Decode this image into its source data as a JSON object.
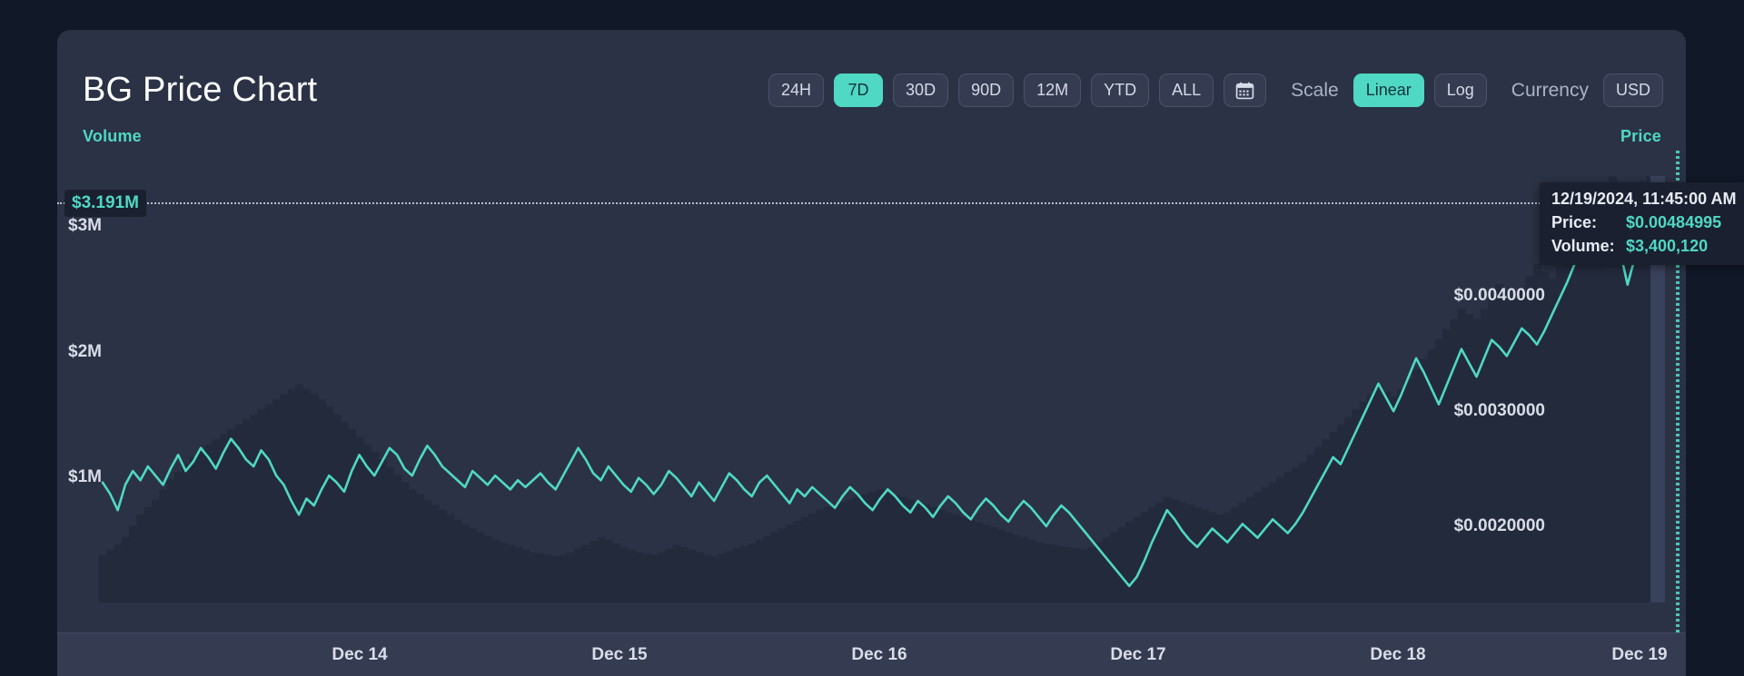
{
  "header": {
    "title": "BG Price Chart",
    "ranges": [
      {
        "label": "24H",
        "active": false
      },
      {
        "label": "7D",
        "active": true
      },
      {
        "label": "30D",
        "active": false
      },
      {
        "label": "90D",
        "active": false
      },
      {
        "label": "12M",
        "active": false
      },
      {
        "label": "YTD",
        "active": false
      },
      {
        "label": "ALL",
        "active": false
      }
    ],
    "calendar_icon": "calendar-icon",
    "scale_label": "Scale",
    "scale_options": [
      {
        "label": "Linear",
        "active": true
      },
      {
        "label": "Log",
        "active": false
      }
    ],
    "currency_label": "Currency",
    "currency_value": "USD"
  },
  "axes": {
    "volume_label": "Volume",
    "price_label": "Price",
    "volume_ticks": [
      "$3M",
      "$2M",
      "$1M"
    ],
    "price_ticks": [
      "$0.0040000",
      "$0.0030000",
      "$0.0020000"
    ],
    "volume_highlight": "$3.191M",
    "x_ticks": [
      "Dec 14",
      "Dec 15",
      "Dec 16",
      "Dec 17",
      "Dec 18",
      "Dec 19"
    ]
  },
  "tooltip": {
    "datetime": "12/19/2024, 11:45:00 AM",
    "price_key": "Price:",
    "price_value": "$0.00484995",
    "volume_key": "Volume:",
    "volume_value": "$3,400,120"
  },
  "colors": {
    "accent": "#4fd8c4",
    "card_bg": "#2b3245",
    "page_bg": "#111827",
    "volume_bar": "#232a3c",
    "text": "#d8dde8"
  },
  "chart_data": {
    "type": "line",
    "title": "BG Price Chart",
    "xlabel": "",
    "ylabel": "Price",
    "y2label": "Volume",
    "grid": false,
    "legend": "none",
    "x_range": [
      "Dec 13",
      "Dec 19"
    ],
    "price_ylim": [
      0.0014,
      0.00495
    ],
    "volume_ylim": [
      0,
      3400000
    ],
    "currency": "USD",
    "scale": "Linear",
    "range_selected": "7D",
    "highlight_point": {
      "datetime": "12/19/2024, 11:45:00 AM",
      "price": 0.00484995,
      "volume": 3400120
    },
    "series": [
      {
        "name": "Price",
        "type": "line",
        "color": "#4fd8c4",
        "unit": "USD",
        "values": [
          0.00238,
          0.00228,
          0.00214,
          0.00236,
          0.00248,
          0.0024,
          0.00252,
          0.00244,
          0.00236,
          0.0025,
          0.00262,
          0.00248,
          0.00256,
          0.00268,
          0.0026,
          0.0025,
          0.00264,
          0.00276,
          0.00268,
          0.00258,
          0.00252,
          0.00266,
          0.00258,
          0.00244,
          0.00236,
          0.00222,
          0.0021,
          0.00224,
          0.00218,
          0.00232,
          0.00244,
          0.00238,
          0.0023,
          0.00248,
          0.00262,
          0.00252,
          0.00244,
          0.00256,
          0.00268,
          0.00262,
          0.0025,
          0.00244,
          0.00258,
          0.0027,
          0.00262,
          0.00252,
          0.00246,
          0.0024,
          0.00234,
          0.00248,
          0.00242,
          0.00236,
          0.00244,
          0.00238,
          0.00232,
          0.0024,
          0.00234,
          0.0024,
          0.00246,
          0.00238,
          0.00232,
          0.00244,
          0.00256,
          0.00268,
          0.00258,
          0.00246,
          0.0024,
          0.00252,
          0.00244,
          0.00236,
          0.0023,
          0.00242,
          0.00236,
          0.00228,
          0.00236,
          0.00248,
          0.00242,
          0.00234,
          0.00226,
          0.00238,
          0.0023,
          0.00222,
          0.00234,
          0.00246,
          0.0024,
          0.00232,
          0.00226,
          0.00238,
          0.00244,
          0.00236,
          0.00228,
          0.0022,
          0.00232,
          0.00226,
          0.00234,
          0.00228,
          0.00222,
          0.00216,
          0.00226,
          0.00234,
          0.00228,
          0.0022,
          0.00214,
          0.00224,
          0.00232,
          0.00226,
          0.00218,
          0.00212,
          0.00222,
          0.00216,
          0.00208,
          0.00218,
          0.00226,
          0.0022,
          0.00212,
          0.00206,
          0.00216,
          0.00224,
          0.00218,
          0.0021,
          0.00204,
          0.00214,
          0.00222,
          0.00216,
          0.00208,
          0.002,
          0.0021,
          0.00218,
          0.00212,
          0.00204,
          0.00196,
          0.00188,
          0.0018,
          0.00172,
          0.00164,
          0.00156,
          0.00148,
          0.00156,
          0.0017,
          0.00186,
          0.002,
          0.00214,
          0.00206,
          0.00196,
          0.00188,
          0.00182,
          0.0019,
          0.00198,
          0.00192,
          0.00186,
          0.00194,
          0.00202,
          0.00196,
          0.0019,
          0.00198,
          0.00206,
          0.002,
          0.00194,
          0.00202,
          0.00212,
          0.00224,
          0.00236,
          0.00248,
          0.0026,
          0.00254,
          0.00268,
          0.00282,
          0.00296,
          0.0031,
          0.00324,
          0.00312,
          0.003,
          0.00314,
          0.0033,
          0.00346,
          0.00334,
          0.0032,
          0.00306,
          0.00322,
          0.00338,
          0.00354,
          0.00342,
          0.0033,
          0.00346,
          0.00362,
          0.00356,
          0.00348,
          0.0036,
          0.00372,
          0.00366,
          0.00358,
          0.0037,
          0.00384,
          0.00398,
          0.00412,
          0.00428,
          0.00442,
          0.00456,
          0.0047,
          0.00484,
          0.00472,
          0.0044,
          0.0041,
          0.00434,
          0.00462,
          0.0048,
          0.00485
        ]
      },
      {
        "name": "Volume",
        "type": "bar",
        "color": "#232a3c",
        "unit": "USD",
        "values": [
          380000,
          420000,
          460000,
          520000,
          610000,
          700000,
          760000,
          820000,
          900000,
          980000,
          1040000,
          1100000,
          1160000,
          1220000,
          1260000,
          1300000,
          1340000,
          1380000,
          1420000,
          1460000,
          1500000,
          1540000,
          1580000,
          1620000,
          1660000,
          1700000,
          1740000,
          1700000,
          1660000,
          1620000,
          1560000,
          1500000,
          1440000,
          1380000,
          1320000,
          1260000,
          1200000,
          1140000,
          1080000,
          1020000,
          960000,
          900000,
          860000,
          820000,
          780000,
          740000,
          700000,
          660000,
          620000,
          590000,
          560000,
          530000,
          500000,
          480000,
          460000,
          440000,
          420000,
          400000,
          390000,
          380000,
          370000,
          380000,
          400000,
          430000,
          460000,
          490000,
          520000,
          500000,
          470000,
          440000,
          420000,
          400000,
          390000,
          380000,
          400000,
          430000,
          460000,
          440000,
          420000,
          400000,
          380000,
          370000,
          390000,
          410000,
          430000,
          450000,
          470000,
          500000,
          530000,
          560000,
          590000,
          620000,
          650000,
          680000,
          710000,
          740000,
          760000,
          780000,
          800000,
          820000,
          840000,
          860000,
          880000,
          900000,
          880000,
          860000,
          840000,
          820000,
          800000,
          780000,
          760000,
          740000,
          720000,
          700000,
          680000,
          660000,
          640000,
          620000,
          600000,
          580000,
          560000,
          540000,
          520000,
          500000,
          480000,
          470000,
          460000,
          450000,
          440000,
          430000,
          420000,
          440000,
          480000,
          520000,
          560000,
          600000,
          640000,
          680000,
          720000,
          760000,
          800000,
          840000,
          820000,
          800000,
          780000,
          760000,
          740000,
          720000,
          700000,
          720000,
          760000,
          800000,
          840000,
          880000,
          920000,
          960000,
          1000000,
          1040000,
          1080000,
          1120000,
          1180000,
          1240000,
          1300000,
          1360000,
          1420000,
          1480000,
          1540000,
          1600000,
          1660000,
          1720000,
          1680000,
          1640000,
          1700000,
          1780000,
          1860000,
          1940000,
          2020000,
          2100000,
          2180000,
          2260000,
          2340000,
          2300000,
          2260000,
          2340000,
          2440000,
          2540000,
          2480000,
          2420000,
          2500000,
          2600000,
          2700000,
          2640000,
          2580000,
          2680000,
          2800000,
          2920000,
          3040000,
          3160000,
          3280000,
          3340000,
          3400000,
          3340000,
          3260000,
          3300000,
          3360000,
          3400000,
          3400000
        ]
      }
    ]
  }
}
